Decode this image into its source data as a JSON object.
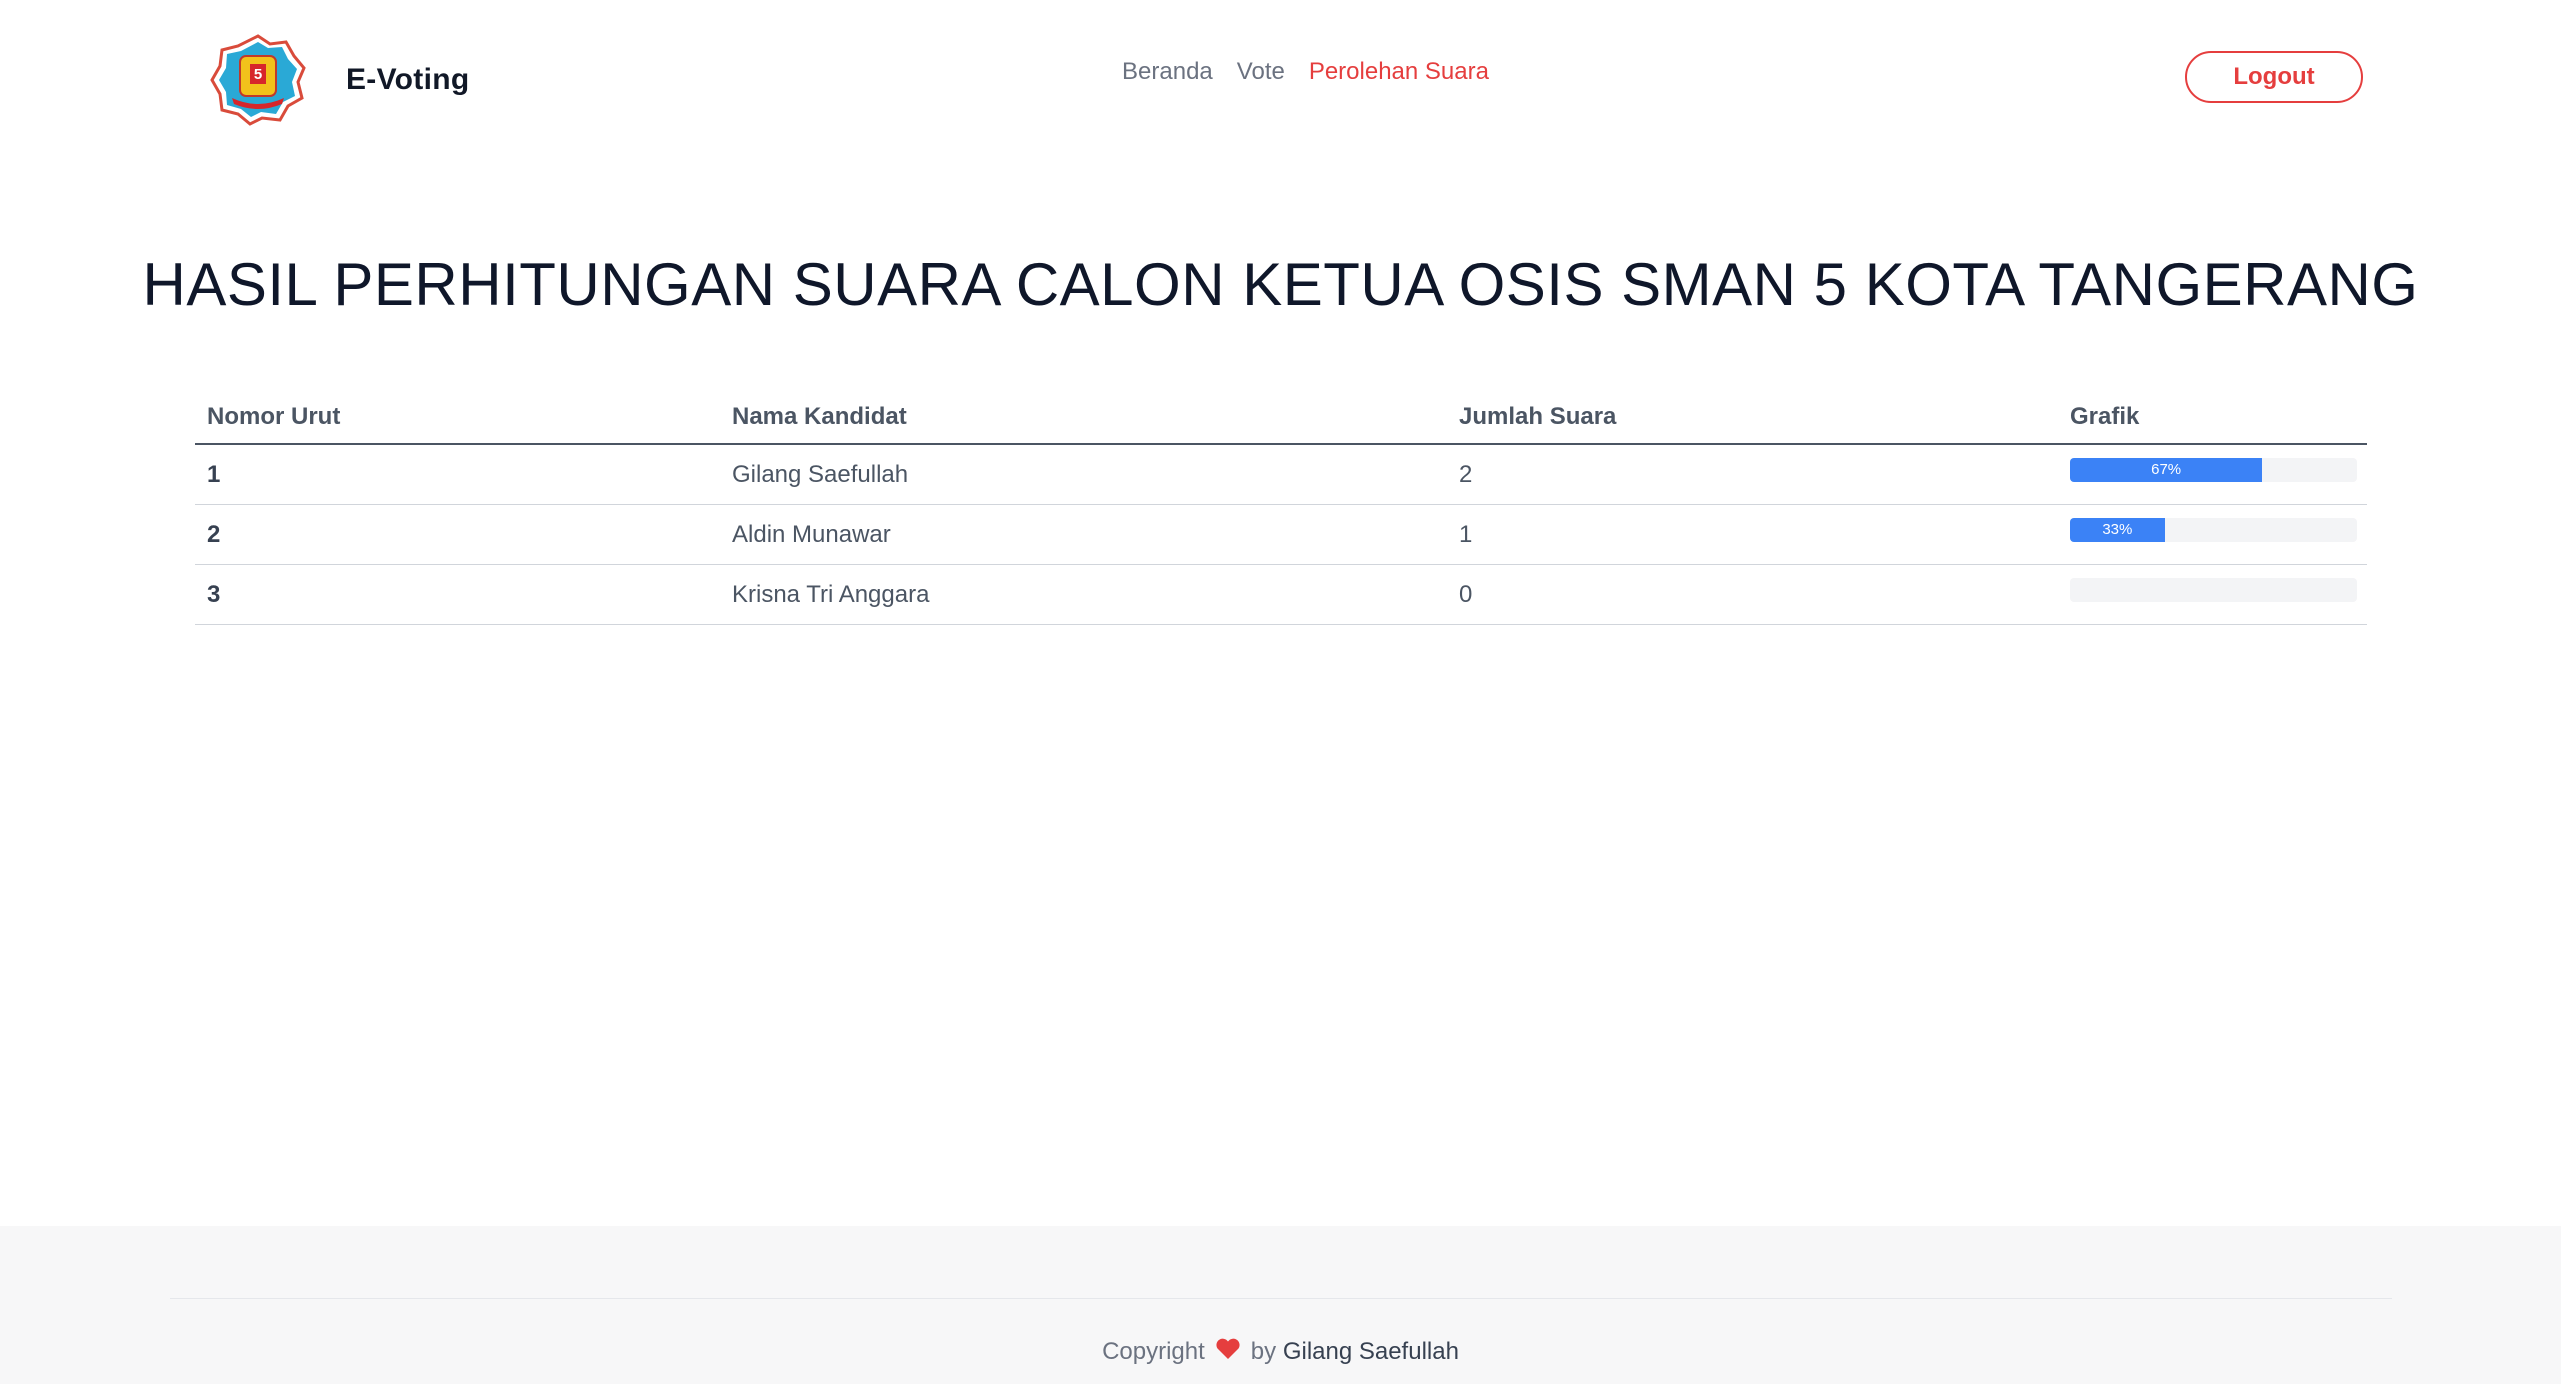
{
  "navbar": {
    "brand": "E-Voting",
    "logo_number": "5",
    "links": [
      {
        "label": "Beranda",
        "active": false
      },
      {
        "label": "Vote",
        "active": false
      },
      {
        "label": "Perolehan Suara",
        "active": true
      }
    ],
    "logout_label": "Logout"
  },
  "title": "HASIL PERHITUNGAN SUARA CALON KETUA OSIS SMAN 5 KOTA TANGERANG",
  "table": {
    "headers": [
      "Nomor Urut",
      "Nama Kandidat",
      "Jumlah Suara",
      "Grafik"
    ],
    "rows": [
      {
        "nomor": "1",
        "nama": "Gilang Saefullah",
        "suara": "2",
        "percent": 67,
        "percent_label": "67%"
      },
      {
        "nomor": "2",
        "nama": "Aldin Munawar",
        "suara": "1",
        "percent": 33,
        "percent_label": "33%"
      },
      {
        "nomor": "3",
        "nama": "Krisna Tri Anggara",
        "suara": "0",
        "percent": 0,
        "percent_label": ""
      }
    ]
  },
  "footer": {
    "copyright": "Copyright",
    "by": "by",
    "author": "Gilang Saefullah"
  },
  "colors": {
    "accent": "#e53e3e",
    "bar": "#3b82f6",
    "heart": "#e53e3e"
  },
  "icons": {
    "logo": "school-emblem-icon",
    "heart": "heart-icon"
  }
}
